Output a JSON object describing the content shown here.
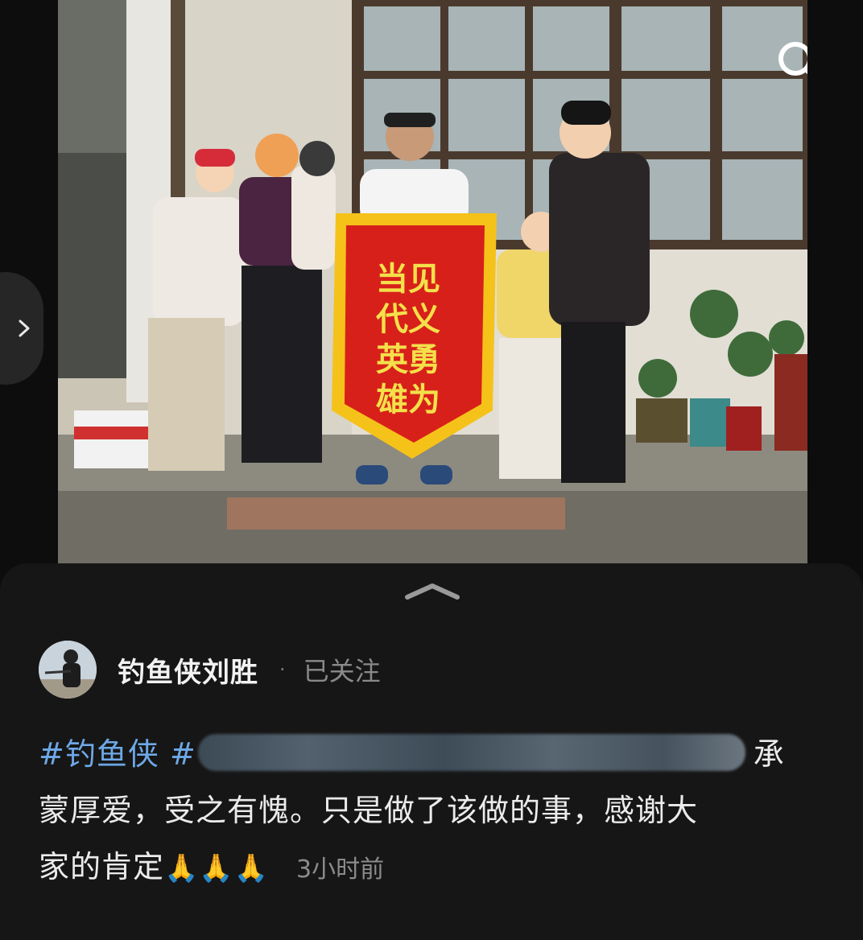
{
  "post": {
    "banner_line1": "见义勇为",
    "banner_line2": "当代英雄"
  },
  "author": {
    "name": "钓鱼侠刘胜",
    "separator": "·",
    "follow_status": "已关注"
  },
  "caption": {
    "hashtag": "#钓鱼侠",
    "hashtag2_start": "#",
    "text_line1_end": "承",
    "text_line2": "蒙厚爱，受之有愧。只是做了该做的事，感谢大",
    "text_line3": "家的肯定",
    "emojis": "🙏🙏🙏",
    "timestamp": "3小时前"
  },
  "icons": {
    "search": "search-icon",
    "side_arrow": "chevron-right-icon",
    "handle": "chevron-up-icon"
  },
  "colors": {
    "hashtag": "#6ea8e6",
    "background": "#0d0d0d",
    "sheet": "#161616"
  }
}
